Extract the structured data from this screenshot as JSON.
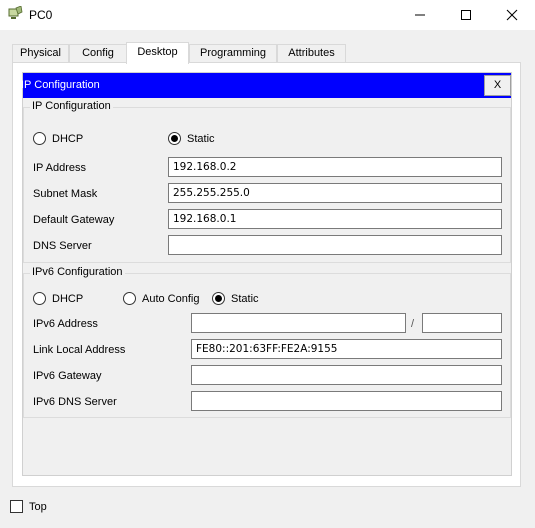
{
  "window": {
    "title": "PC0",
    "icon": "pc-device-icon",
    "controls": [
      "minimize-icon",
      "maximize-icon",
      "close-icon"
    ]
  },
  "tabs": [
    {
      "label": "Physical",
      "active": false
    },
    {
      "label": "Config",
      "active": false
    },
    {
      "label": "Desktop",
      "active": true
    },
    {
      "label": "Programming",
      "active": false
    },
    {
      "label": "Attributes",
      "active": false
    }
  ],
  "app": {
    "title": "IP Configuration",
    "close_label": "X",
    "header_color": "#0000ff"
  },
  "ipv4": {
    "title": "IP Configuration",
    "dhcp_label": "DHCP",
    "static_label": "Static",
    "mode": "static",
    "ip_label": "IP Address",
    "ip_value": "192.168.0.2",
    "mask_label": "Subnet Mask",
    "mask_value": "255.255.255.0",
    "gateway_label": "Default Gateway",
    "gateway_value": "192.168.0.1",
    "dns_label": "DNS Server",
    "dns_value": ""
  },
  "ipv6": {
    "title": "IPv6 Configuration",
    "dhcp_label": "DHCP",
    "auto_label": "Auto Config",
    "static_label": "Static",
    "mode": "static",
    "address_label": "IPv6 Address",
    "address_value": "",
    "separator": "/",
    "prefix_value": "",
    "link_local_label": "Link Local Address",
    "link_local_value": "FE80::201:63FF:FE2A:9155",
    "gateway_label": "IPv6 Gateway",
    "gateway_value": "",
    "dns_label": "IPv6 DNS Server",
    "dns_value": ""
  },
  "footer": {
    "top_label": "Top",
    "top_checked": false
  }
}
